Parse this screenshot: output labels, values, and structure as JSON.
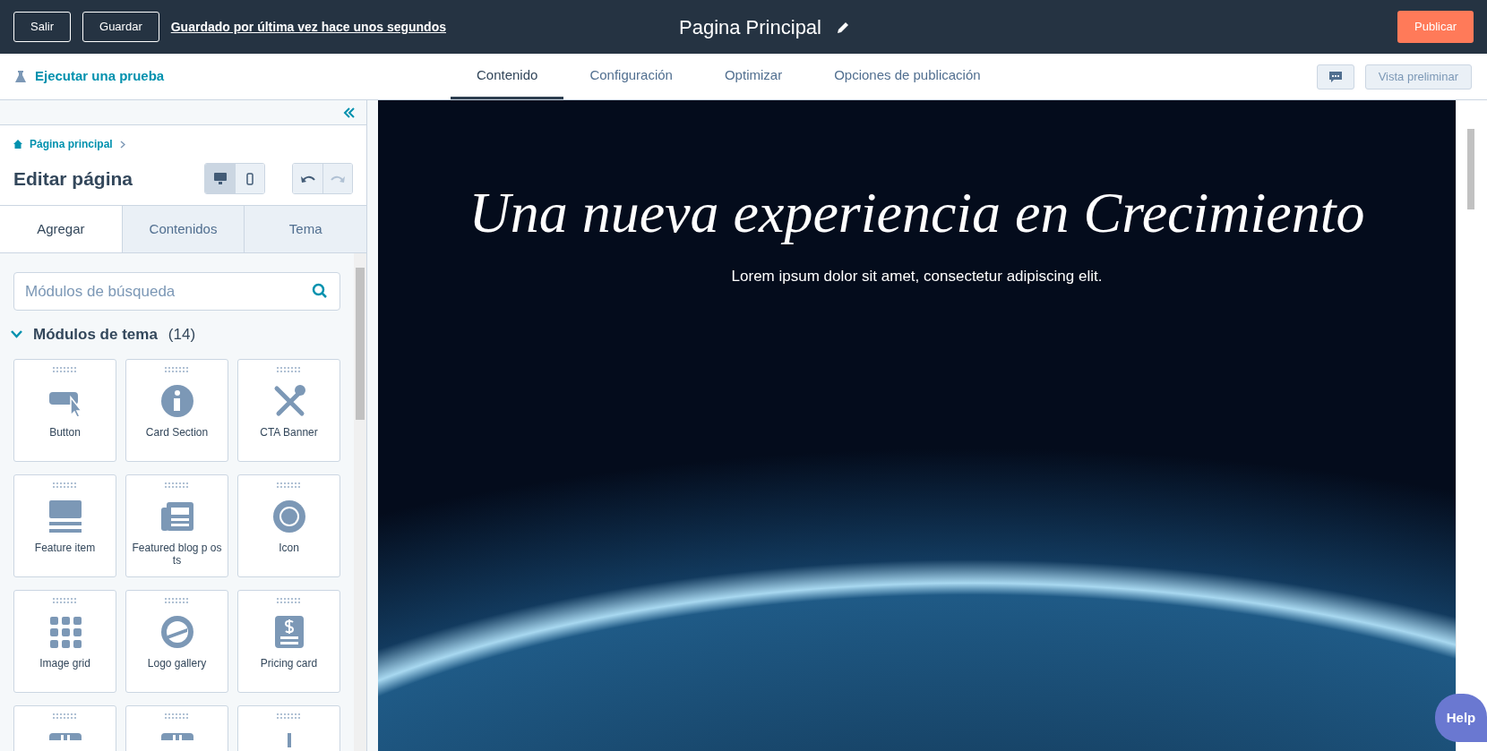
{
  "top_bar": {
    "buttons": [
      "Salir",
      "Guardar"
    ],
    "save_status": "Guardado por última vez hace unos segundos",
    "page_title": "Pagina Principal",
    "publish": "Publicar"
  },
  "sub_bar": {
    "test_link": "Ejecutar una prueba",
    "tabs": [
      {
        "label": "Contenido",
        "selected": true
      },
      {
        "label": "Configuración",
        "selected": false
      },
      {
        "label": "Optimizar",
        "selected": false
      },
      {
        "label": "Opciones de publicación",
        "selected": false
      }
    ],
    "preview_button": {
      "label": "Vista preliminar",
      "disabled": true
    }
  },
  "sidebar": {
    "breadcrumb": "Página principal",
    "title": "Editar página",
    "devices": [
      {
        "kind": "desktop",
        "selected": true
      },
      {
        "kind": "mobile",
        "selected": false
      }
    ],
    "history": [
      {
        "kind": "undo",
        "disabled": false
      },
      {
        "kind": "redo",
        "disabled": true
      }
    ],
    "tabs": [
      {
        "label": "Agregar",
        "selected": true
      },
      {
        "label": "Contenidos",
        "selected": false
      },
      {
        "label": "Tema",
        "selected": false
      }
    ],
    "search": {
      "placeholder": "Módulos de búsqueda"
    },
    "section": {
      "title": "Módulos de tema",
      "count": "(14)",
      "expanded": true
    },
    "modules": [
      {
        "kind": "button",
        "label": "Button"
      },
      {
        "kind": "info",
        "label": "Card Section"
      },
      {
        "kind": "tools",
        "label": "CTA Banner"
      },
      {
        "kind": "feature",
        "label": "Feature item"
      },
      {
        "kind": "news",
        "label": "Featured blog p osts"
      },
      {
        "kind": "badge",
        "label": "Icon"
      },
      {
        "kind": "grid",
        "label": "Image grid"
      },
      {
        "kind": "logo",
        "label": "Logo gallery"
      },
      {
        "kind": "pricing",
        "label": "Pricing card"
      },
      {
        "kind": "calendar"
      },
      {
        "kind": "calendar"
      },
      {
        "kind": "pin"
      }
    ]
  },
  "preview": {
    "headline": "Una nueva experiencia en Crecimiento",
    "subheadline": "Lorem ipsum dolor sit amet, consectetur adipiscing elit.",
    "help": "Help"
  }
}
